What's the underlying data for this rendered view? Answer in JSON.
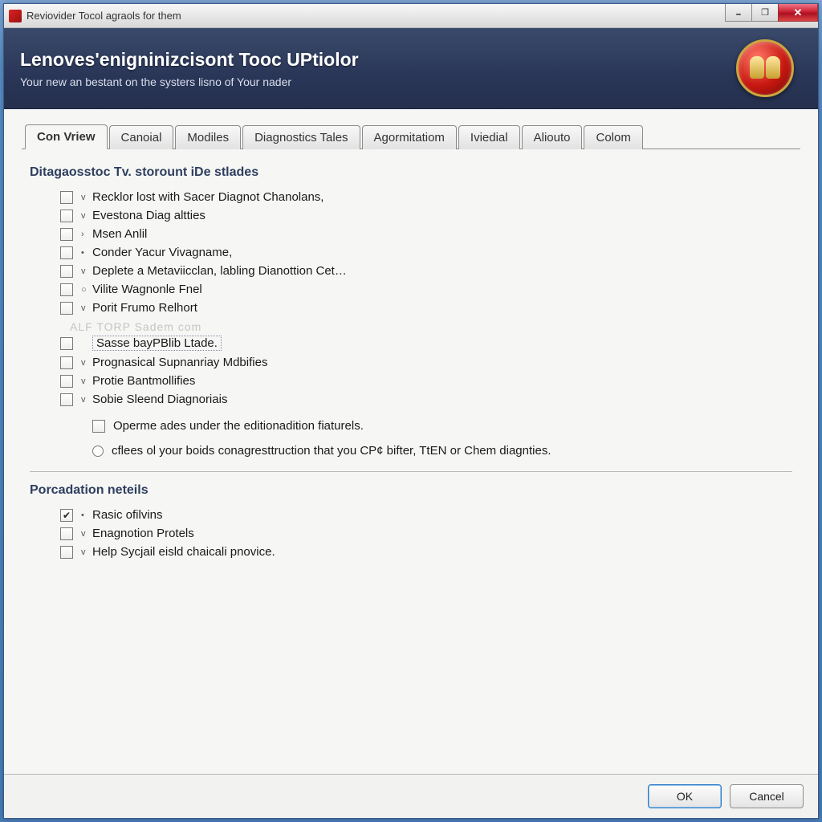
{
  "window": {
    "title": "Reviovider Tocol agraols for them"
  },
  "banner": {
    "heading": "Lenoves'enigninizcisont Tooc UPtiolor",
    "subheading": "Your new an bestant on the systers lisno of Your nader"
  },
  "tabs": [
    {
      "label": "Con Vriew",
      "active": true
    },
    {
      "label": "Canoial",
      "active": false
    },
    {
      "label": "Modiles",
      "active": false
    },
    {
      "label": "Diagnostics Tales",
      "active": false
    },
    {
      "label": "Agormitatiom",
      "active": false
    },
    {
      "label": "Iviedial",
      "active": false
    },
    {
      "label": "Aliouto",
      "active": false
    },
    {
      "label": "Colom",
      "active": false
    }
  ],
  "section1": {
    "title": "Ditagaosstoc Tv. storount iDe stlades",
    "items": [
      {
        "label": "Recklor lost with Sacer Diagnot Chanolans,",
        "checked": false
      },
      {
        "label": "Evestona Diag altties",
        "checked": false
      },
      {
        "label": "Msen Anlil",
        "checked": false
      },
      {
        "label": "Conder Yacur Vivagname,",
        "checked": false
      },
      {
        "label": "Deplete a Metaviicclan, labling Dianottion Cet…",
        "checked": false
      },
      {
        "label": "Vilite Wagnonle Fnel",
        "checked": false
      },
      {
        "label": "Porit Frumo Relhort",
        "checked": false
      },
      {
        "label": "Sasse bayPBlib Ltade.",
        "checked": false
      },
      {
        "label": "Prognasical Supnanriay Mdbifies",
        "checked": false
      },
      {
        "label": "Protie Bantmollifies",
        "checked": false
      },
      {
        "label": "Sobie Sleend Diagnoriais",
        "checked": false
      }
    ],
    "sub_checkbox": "Operme ades under the editionadition fiaturels.",
    "info_text": "cflees ol your boids conagresttruction that you CP¢ bifter, TtEN or Chem diagnties."
  },
  "watermark": "ALF TORP Sadem com",
  "section2": {
    "title": "Porcadation neteils",
    "items": [
      {
        "label": "Rasic ofilvins",
        "checked": true
      },
      {
        "label": "Enagnotion Protels",
        "checked": false
      },
      {
        "label": "Help Sycjail eisld chaicali pnovice.",
        "checked": false
      }
    ]
  },
  "footer": {
    "ok": "OK",
    "cancel": "Cancel"
  }
}
